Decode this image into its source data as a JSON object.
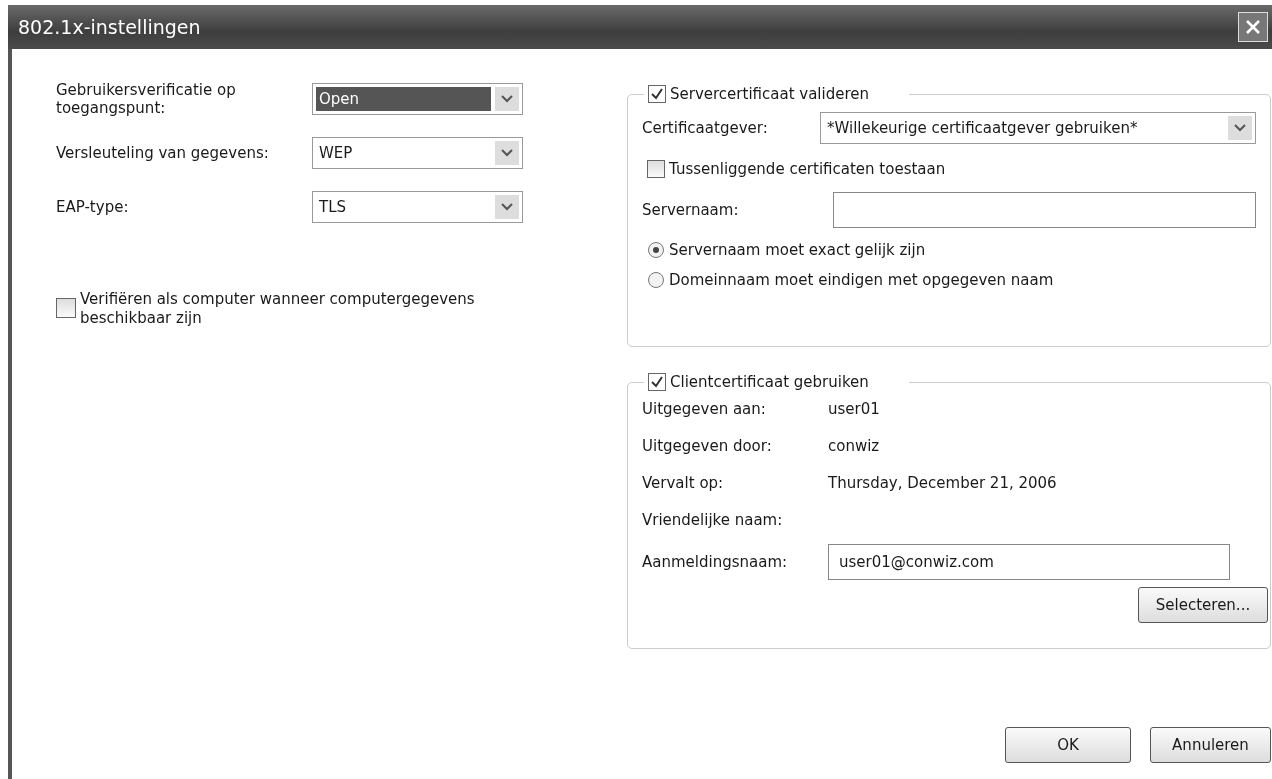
{
  "window": {
    "title": "802.1x-instellingen"
  },
  "left": {
    "fields": [
      {
        "label": "Gebruikersverificatie op toegangspunt:",
        "value": "Open",
        "focused": true
      },
      {
        "label": "Versleuteling van gegevens:",
        "value": "WEP",
        "focused": false
      },
      {
        "label": "EAP-type:",
        "value": "TLS",
        "focused": false
      }
    ],
    "machine_auth": {
      "label": "Verifiëren als computer wanneer computergegevens beschikbaar zijn",
      "checked": false
    }
  },
  "server_group": {
    "label": "Servercertificaat valideren",
    "checked": true,
    "issuer": {
      "label": "Certificaatgever:",
      "value": "*Willekeurige certificaatgever gebruiken*"
    },
    "intermediate": {
      "label": "Tussenliggende certificaten toestaan",
      "checked": false
    },
    "server_name": {
      "label": "Servernaam:"
    },
    "match": [
      {
        "label": "Servernaam moet exact gelijk zijn",
        "selected": true
      },
      {
        "label": "Domeinnaam moet eindigen met opgegeven naam",
        "selected": false
      }
    ]
  },
  "client_group": {
    "label": "Clientcertificaat gebruiken",
    "checked": true,
    "info": [
      {
        "label": "Uitgegeven aan:",
        "value": "user01"
      },
      {
        "label": "Uitgegeven door:",
        "value": "conwiz"
      },
      {
        "label": "Vervalt op:",
        "value": "Thursday, December 21, 2006"
      },
      {
        "label": "Vriendelijke naam:"
      }
    ],
    "login": {
      "label": "Aanmeldingsnaam:",
      "value": "user01@conwiz.com"
    },
    "select_button": "Selecteren..."
  },
  "buttons": [
    "OK",
    "Annuleren"
  ]
}
